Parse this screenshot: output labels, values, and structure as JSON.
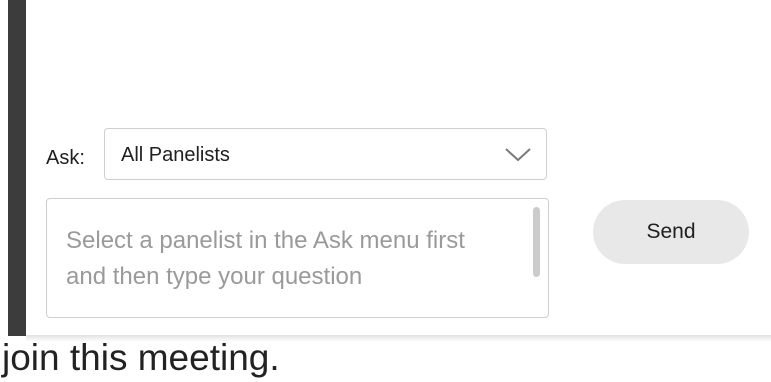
{
  "qa_panel": {
    "ask_label": "Ask:",
    "ask_select": {
      "selected": "All Panelists"
    },
    "question": {
      "value": "",
      "placeholder": "Select a panelist in the Ask menu first and then type your question"
    },
    "send_label": "Send"
  },
  "background_text": "join this meeting.",
  "colors": {
    "left_bar": "#3c3c3c",
    "send_button_bg": "#e8e8e8",
    "border": "#cfcfcf",
    "placeholder": "#9a9a9a"
  }
}
